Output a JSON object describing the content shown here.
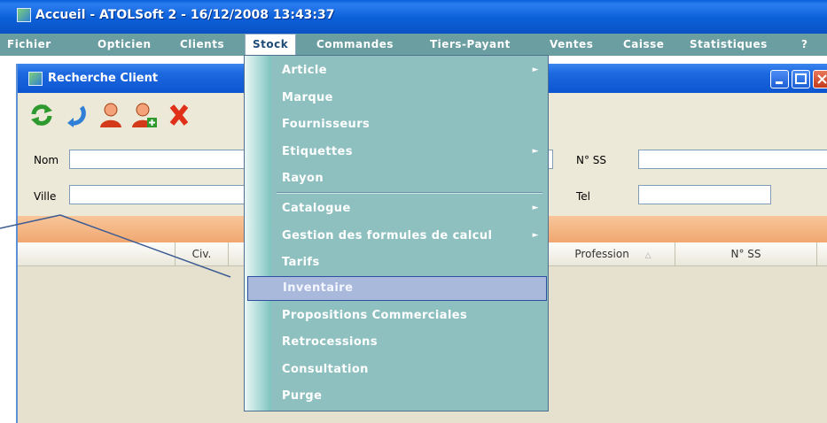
{
  "window": {
    "title": "Accueil - ATOLSoft 2 - 16/12/2008 13:43:37"
  },
  "menubar": {
    "items": [
      "Fichier",
      "Opticien",
      "Clients",
      "Stock",
      "Commandes",
      "Tiers-Payant",
      "Ventes",
      "Caisse",
      "Statistiques",
      "?"
    ],
    "active": "Stock"
  },
  "child_window": {
    "title": "Recherche Client"
  },
  "toolbar": {
    "icons": [
      "refresh-icon",
      "undo-icon",
      "user-icon",
      "add-user-icon",
      "delete-icon"
    ]
  },
  "form": {
    "nom_label": "Nom",
    "ville_label": "Ville",
    "nss_label": "N° SS",
    "tel_label": "Tel"
  },
  "table": {
    "columns": [
      "Civ.",
      "Profession",
      "N° SS"
    ]
  },
  "stock_menu": {
    "items": [
      {
        "label": "Article",
        "submenu": true
      },
      {
        "label": "Marque",
        "submenu": false
      },
      {
        "label": "Fournisseurs",
        "submenu": false
      },
      {
        "label": "Etiquettes",
        "submenu": true
      },
      {
        "label": "Rayon",
        "submenu": false
      },
      {
        "label": "Catalogue",
        "submenu": true
      },
      {
        "label": "Gestion des formules de calcul",
        "submenu": true
      },
      {
        "label": "Tarifs",
        "submenu": false
      },
      {
        "label": "Inventaire",
        "submenu": false
      },
      {
        "label": "Propositions Commerciales",
        "submenu": false
      },
      {
        "label": "Retrocessions",
        "submenu": false
      },
      {
        "label": "Consultation",
        "submenu": false
      },
      {
        "label": "Purge",
        "submenu": false
      }
    ],
    "highlighted": "Inventaire",
    "submenu_arrow": "►"
  },
  "colors": {
    "menubar": "#6b9ea0",
    "dropdown": "#8fc0c0",
    "highlight": "#a9b9dc",
    "titlebar": "#0c5fd8"
  }
}
